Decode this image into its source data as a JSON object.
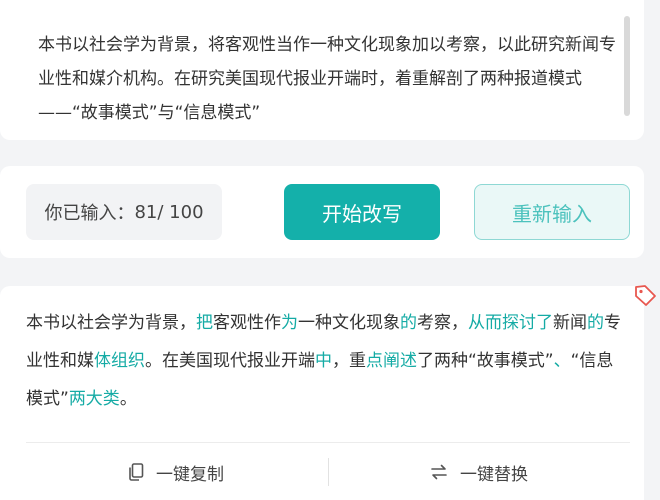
{
  "input": {
    "text": "本书以社会学为背景，将客观性当作一种文化现象加以考察，以此研究新闻专业性和媒介机构。在研究美国现代报业开端时，着重解剖了两种报道模式——“故事模式”与“信息模式”"
  },
  "actions": {
    "counter_label": "你已输入：",
    "counter_value": "81/ 100",
    "start_label": "开始改写",
    "reset_label": "重新输入"
  },
  "result": {
    "segments": [
      {
        "text": "本书以社会学为背景，",
        "hl": false
      },
      {
        "text": "把",
        "hl": true
      },
      {
        "text": "客观性作",
        "hl": false
      },
      {
        "text": "为",
        "hl": true
      },
      {
        "text": "一种文化现象",
        "hl": false
      },
      {
        "text": "的",
        "hl": true
      },
      {
        "text": "考察，",
        "hl": false
      },
      {
        "text": "从而探讨了",
        "hl": true
      },
      {
        "text": "新闻",
        "hl": false
      },
      {
        "text": "的",
        "hl": true
      },
      {
        "text": "专业性和媒",
        "hl": false
      },
      {
        "text": "体组织",
        "hl": true
      },
      {
        "text": "。在美国现代报业开端",
        "hl": false
      },
      {
        "text": "中",
        "hl": true
      },
      {
        "text": "，重",
        "hl": false
      },
      {
        "text": "点阐述",
        "hl": true
      },
      {
        "text": "了两种“故事模式”",
        "hl": false
      },
      {
        "text": "、",
        "hl": true
      },
      {
        "text": "“信息模式”",
        "hl": false
      },
      {
        "text": "两大类",
        "hl": true
      },
      {
        "text": "。",
        "hl": false
      }
    ],
    "copy_label": "一键复制",
    "replace_label": "一键替换"
  },
  "colors": {
    "accent": "#14b0aa",
    "highlight": "#15aba5",
    "tag": "#e8574f"
  },
  "icons": {
    "copy": "copy-icon",
    "replace": "swap-icon",
    "tag": "tag-icon"
  }
}
